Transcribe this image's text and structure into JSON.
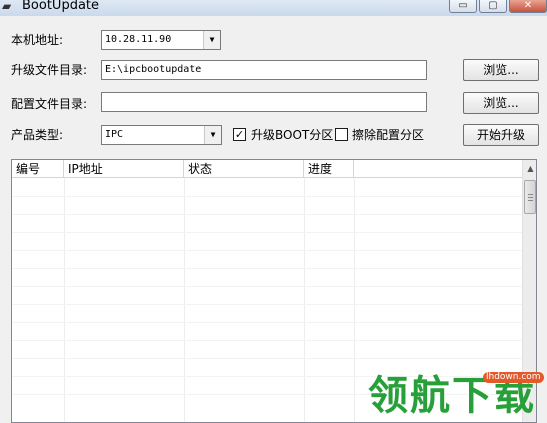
{
  "window": {
    "title": "BootUpdate",
    "icon": "app-icon",
    "controls": {
      "minimize": "▭",
      "maximize": "▢",
      "close": "✕"
    }
  },
  "form": {
    "local_address_label": "本机地址:",
    "local_address_value": "10.28.11.90",
    "upgrade_dir_label": "升级文件目录:",
    "upgrade_dir_value": "E:\\ipcbootupdate",
    "config_dir_label": "配置文件目录:",
    "config_dir_value": "",
    "product_type_label": "产品类型:",
    "product_type_value": "IPC",
    "browse_label": "浏览...",
    "upgrade_boot_label": "升级BOOT分区",
    "upgrade_boot_checked": true,
    "erase_config_label": "擦除配置分区",
    "erase_config_checked": false,
    "start_upgrade_label": "开始升级"
  },
  "table": {
    "columns": [
      "编号",
      "IP地址",
      "状态",
      "进度"
    ],
    "rows": []
  },
  "watermark": {
    "text": "领航下载",
    "url": "lhdown.com"
  }
}
